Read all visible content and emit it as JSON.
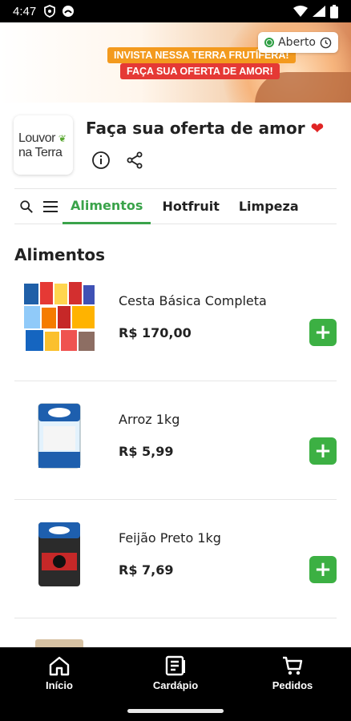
{
  "status_bar": {
    "time": "4:47"
  },
  "banner": {
    "line1": "INVISTA NESSA TERRA FRUTÍFERA!",
    "line2": "FAÇA SUA OFERTA DE AMOR!",
    "status_label": "Aberto",
    "status_color": "#2e9e44"
  },
  "store": {
    "logo_line1": "Louvor",
    "logo_line2": "na Terra",
    "name": "Faça sua oferta de amor",
    "heart": "❤"
  },
  "tabs": [
    {
      "label": "Alimentos",
      "active": true
    },
    {
      "label": "Hotfruit",
      "active": false
    },
    {
      "label": "Limpeza",
      "active": false
    }
  ],
  "section": {
    "title": "Alimentos"
  },
  "products": [
    {
      "name": "Cesta Básica Completa",
      "price": "R$ 170,00"
    },
    {
      "name": "Arroz 1kg",
      "price": "R$ 5,99"
    },
    {
      "name": "Feijão Preto 1kg",
      "price": "R$ 7,69"
    }
  ],
  "add_button_label": "+",
  "bottom_nav": [
    {
      "label": "Início",
      "icon": "home-icon"
    },
    {
      "label": "Cardápio",
      "icon": "menu-book-icon"
    },
    {
      "label": "Pedidos",
      "icon": "cart-icon"
    }
  ],
  "colors": {
    "accent": "#3aa34a",
    "add_button": "#3cb043",
    "nav_bg": "#000000"
  }
}
